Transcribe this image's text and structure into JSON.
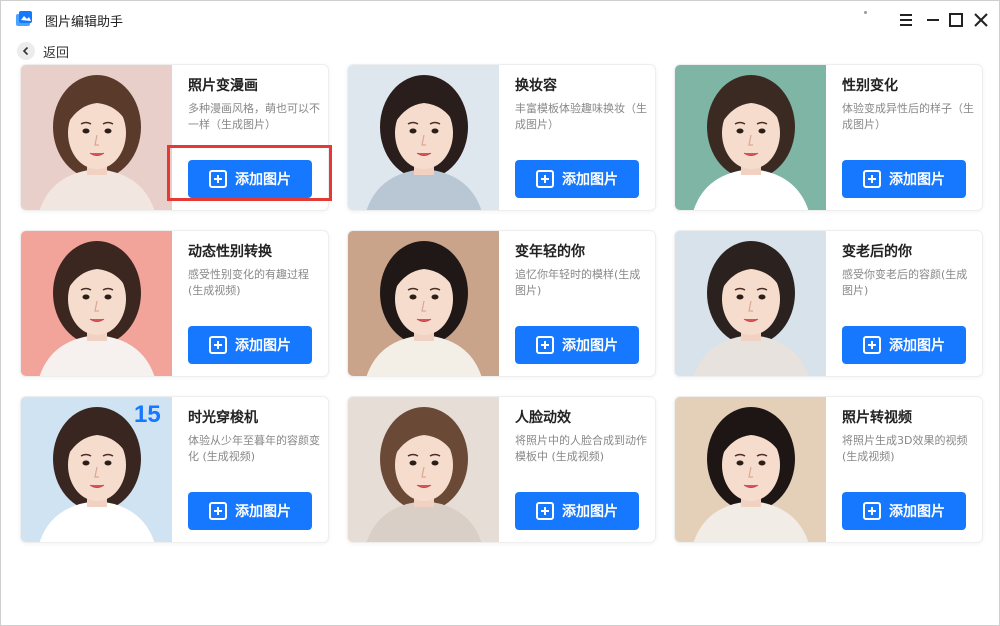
{
  "app": {
    "title": "图片编辑助手",
    "back_label": "返回",
    "accent": "#1677ff",
    "highlight_color": "#e53935"
  },
  "window_controls": [
    "menu-icon",
    "minimize-icon",
    "maximize-icon",
    "close-icon"
  ],
  "cards": [
    {
      "title": "照片变漫画",
      "desc": "多种漫画风格，萌也可以不一样（生成图片）",
      "button": "添加图片",
      "thumb_bg": "#e9cfc9",
      "hair": "#5a3a2a",
      "cloth": "#f2e6e0"
    },
    {
      "title": "换妆容",
      "desc": "丰富模板体验趣味换妆（生成图片）",
      "button": "添加图片",
      "thumb_bg": "#dfe7ee",
      "hair": "#2a1e1c",
      "cloth": "#b8c7d3"
    },
    {
      "title": "性别变化",
      "desc": "体验变成异性后的样子（生成图片）",
      "button": "添加图片",
      "thumb_bg": "#7fb5a4",
      "hair": "#3a2a22",
      "cloth": "#ffffff"
    },
    {
      "title": "动态性别转换",
      "desc": "感受性别变化的有趣过程(生成视频)",
      "button": "添加图片",
      "thumb_bg": "#f2a39a",
      "hair": "#3b2620",
      "cloth": "#f6f1ee"
    },
    {
      "title": "变年轻的你",
      "desc": "追忆你年轻时的模样(生成图片)",
      "button": "添加图片",
      "thumb_bg": "#c9a48a",
      "hair": "#1f1816",
      "cloth": "#f3efe6"
    },
    {
      "title": "变老后的你",
      "desc": "感受你变老后的容颜(生成图片)",
      "button": "添加图片",
      "thumb_bg": "#d7e2ea",
      "hair": "#2b2220",
      "cloth": "#e7e2de"
    },
    {
      "title": "时光穿梭机",
      "desc": "体验从少年至暮年的容颜变化 (生成视频)",
      "button": "添加图片",
      "thumb_bg": "#cfe3f2",
      "hair": "#3a2620",
      "cloth": "#ffffff",
      "badge": "15"
    },
    {
      "title": "人脸动效",
      "desc": "将照片中的人脸合成到动作模板中 (生成视频)",
      "button": "添加图片",
      "thumb_bg": "#e6ddd6",
      "hair": "#6a4a36",
      "cloth": "#d9cfc6"
    },
    {
      "title": "照片转视频",
      "desc": "将照片生成3D效果的视频 (生成视频)",
      "button": "添加图片",
      "thumb_bg": "#e4cfb9",
      "hair": "#1e1614",
      "cloth": "#f1ece6"
    }
  ]
}
